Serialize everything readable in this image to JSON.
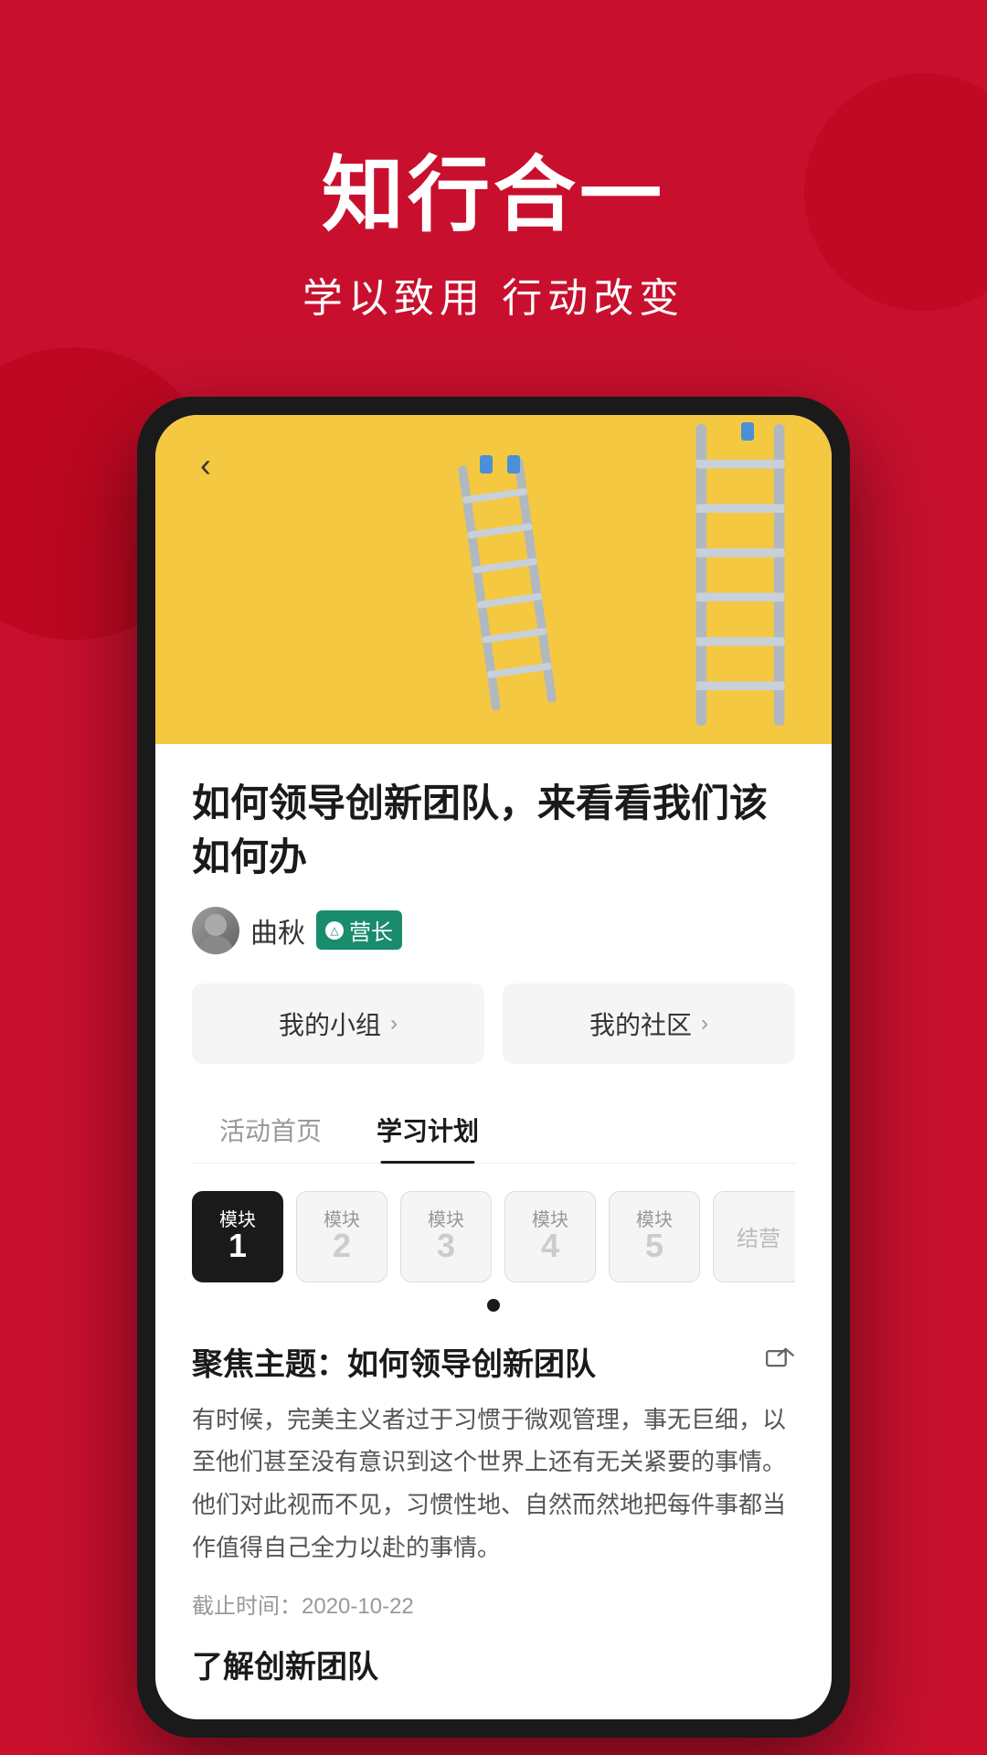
{
  "header": {
    "title": "知行合一",
    "subtitle": "学以致用 行动改变"
  },
  "article": {
    "back_button": "‹",
    "title": "如何领导创新团队，来看看我们该如何办",
    "author_name": "曲秋",
    "author_badge": "营长",
    "nav_buttons": [
      {
        "label": "我的小组",
        "arrow": "›"
      },
      {
        "label": "我的社区",
        "arrow": "›"
      }
    ],
    "tabs": [
      {
        "label": "活动首页",
        "active": false
      },
      {
        "label": "学习计划",
        "active": true
      }
    ],
    "modules": [
      {
        "label": "模块",
        "number": "1",
        "active": true
      },
      {
        "label": "模块",
        "number": "2",
        "active": false
      },
      {
        "label": "模块",
        "number": "3",
        "active": false
      },
      {
        "label": "模块",
        "number": "4",
        "active": false
      },
      {
        "label": "模块",
        "number": "5",
        "active": false
      },
      {
        "label": "结营",
        "number": "",
        "active": false
      }
    ],
    "section_title": "聚焦主题：如何领导创新团队",
    "section_body": "有时候，完美主义者过于习惯于微观管理，事无巨细，以至他们甚至没有意识到这个世界上还有无关紧要的事情。他们对此视而不见，习惯性地、自然而然地把每件事都当作值得自己全力以赴的事情。",
    "deadline": "截止时间：2020-10-22",
    "sub_section_title": "了解创新团队"
  }
}
